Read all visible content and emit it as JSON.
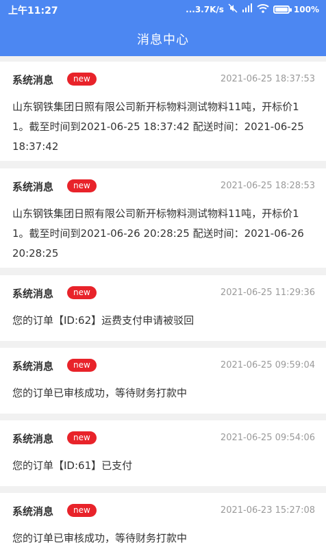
{
  "status_bar": {
    "time": "上午11:27",
    "speed": "...3.7K/s",
    "battery": "100%"
  },
  "header": {
    "title": "消息中心",
    "color": "#4c87f2"
  },
  "messages": [
    {
      "sender": "系统消息",
      "badge": "new",
      "time": "2021-06-25 18:37:53",
      "content": "山东钢铁集团日照有限公司新开标物料测试物料11吨，开标价11。截至时间到2021-06-25 18:37:42 配送时间：2021-06-25 18:37:42"
    },
    {
      "sender": "系统消息",
      "badge": "new",
      "time": "2021-06-25 18:28:53",
      "content": "山东钢铁集团日照有限公司新开标物料测试物料11吨，开标价11。截至时间到2021-06-26 20:28:25 配送时间：2021-06-26 20:28:25"
    },
    {
      "sender": "系统消息",
      "badge": "new",
      "time": "2021-06-25 11:29:36",
      "content": "您的订单【ID:62】运费支付申请被驳回"
    },
    {
      "sender": "系统消息",
      "badge": "new",
      "time": "2021-06-25 09:59:04",
      "content": "您的订单已审核成功，等待财务打款中"
    },
    {
      "sender": "系统消息",
      "badge": "new",
      "time": "2021-06-25 09:54:06",
      "content": "您的订单【ID:61】已支付"
    },
    {
      "sender": "系统消息",
      "badge": "new",
      "time": "2021-06-23 15:27:08",
      "content": "您的订单已审核成功，等待财务打款中"
    }
  ],
  "colors": {
    "badge": "#e8232a",
    "background": "#f1f1f1"
  }
}
